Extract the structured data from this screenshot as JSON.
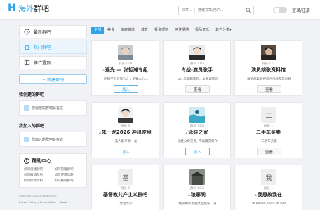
{
  "header": {
    "logo_mark": "H",
    "logo_hl": "海外",
    "logo_rest": "群吧",
    "search_type": "文章",
    "search_placeholder": "搜索文章/用户...",
    "login_label": "登录/注册"
  },
  "sidebar": {
    "items": [
      {
        "label": "最新群吧",
        "icon": "clock-icon",
        "active": false
      },
      {
        "label": "热门群吧",
        "icon": "home-icon",
        "active": true
      },
      {
        "label": "推广置顶",
        "icon": "book-icon",
        "active": false
      }
    ],
    "new_button": "+ 新建群吧",
    "my_created_title": "我创建的群吧",
    "my_created_empty": "您创建的群吧会在这",
    "my_joined_title": "我加入的群吧",
    "my_joined_empty": "您加入的群吧会在这",
    "help_title": "帮助中心",
    "help_links": [
      "如何创建群吧",
      "如何管理群吧",
      "如何邀请群员",
      "如何使用话题",
      "如何修改资料",
      "如何删除群吧"
    ],
    "footer_copyright": "Copyright ©2024 Haiwai.com",
    "footer_links": [
      "Privacy Policy",
      "|",
      "Terms of Use",
      "|",
      "About"
    ]
  },
  "filters": [
    "全部",
    "美食",
    "家庭装修",
    "教育",
    "投资理财",
    "两性情感",
    "极品音乐",
    "其它分类"
  ],
  "active_filter": "全部",
  "cards": [
    {
      "members": "群员 179",
      "name": "逼光 — 张哲瀚专组",
      "lock": true,
      "desc": "明知不可为而为之，明知人心...",
      "button": "加入",
      "btn_type": "join",
      "avatar": "photo1"
    },
    {
      "members": "群员 110",
      "name": "肖战-演员歌手",
      "lock": false,
      "desc": "以才华麒麟羊兆，以真诚志亮",
      "button": "查看",
      "btn_type": "view",
      "avatar": "photo2"
    },
    {
      "members": "群员 171",
      "name": "演员胡歌资料馆",
      "lock": false,
      "desc": "演员胡歌影视综合作品及其他精",
      "button": "查看",
      "btn_type": "view",
      "avatar": "photo3"
    },
    {
      "members": "群员 3",
      "name": "朱一龙2026 冲出逆境",
      "lock": true,
      "desc": "美人影亭亭一龙",
      "button": "加入",
      "btn_type": "join",
      "avatar": "photo4"
    },
    {
      "members": "群员 796",
      "name": "泳娃之家",
      "lock": true,
      "desc": "泳娃父母交流, 申请需交简介",
      "button": "加入",
      "btn_type": "join",
      "avatar": "photo5"
    },
    {
      "members": "群员 1",
      "name": "二手车买卖",
      "lock": false,
      "desc": "二手车买卖",
      "button": "查看",
      "btn_type": "view",
      "avatar": "letter",
      "letter": "二"
    },
    {
      "members": "群员 5",
      "name": "基督教共产主义群吧",
      "lock": false,
      "desc": "文化文学",
      "button": "",
      "btn_type": "none",
      "avatar": "letter",
      "letter": "基"
    },
    {
      "members": "群员 683",
      "name": "琅琊阁",
      "lock": true,
      "desc": "畅谈中外影视文艺娱乐，海",
      "button": "",
      "btn_type": "none",
      "avatar": "photo6"
    },
    {
      "members": "群员 1",
      "name": "我思故我在",
      "lock": true,
      "desc": "Je pense, donc je suis",
      "button": "",
      "btn_type": "none",
      "avatar": "letter",
      "letter": "我"
    }
  ],
  "colors": {
    "accent": "#32a3e8",
    "bg": "#f1f2f5"
  }
}
